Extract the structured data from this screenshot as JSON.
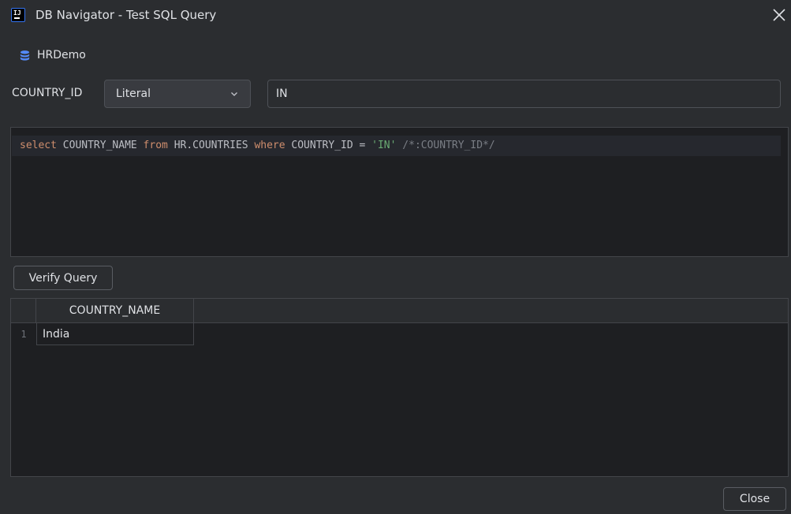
{
  "window": {
    "title": "DB Navigator - Test SQL Query",
    "app_icon_text": "IJ"
  },
  "connection": {
    "name": "HRDemo",
    "icon": "database-icon"
  },
  "parameter": {
    "name": "COUNTRY_ID",
    "type_selected": "Literal",
    "value": "IN"
  },
  "editor": {
    "tokens": {
      "select": "select ",
      "cols": "COUNTRY_NAME ",
      "from": "from ",
      "table": "HR.COUNTRIES ",
      "where": "where ",
      "cond": "COUNTRY_ID = ",
      "literal": "'IN'",
      "space": " ",
      "comment": "/*:COUNTRY_ID*/"
    }
  },
  "buttons": {
    "verify": "Verify Query",
    "close": "Close"
  },
  "results": {
    "columns": [
      "COUNTRY_NAME"
    ],
    "rows": [
      {
        "num": "1",
        "values": [
          "India"
        ]
      }
    ]
  },
  "colors": {
    "background": "#2b2d30",
    "editor_bg": "#1e1f22",
    "keyword": "#cf8e6d",
    "string": "#6aab73",
    "comment": "#7a7e85",
    "accent": "#3574f0"
  }
}
